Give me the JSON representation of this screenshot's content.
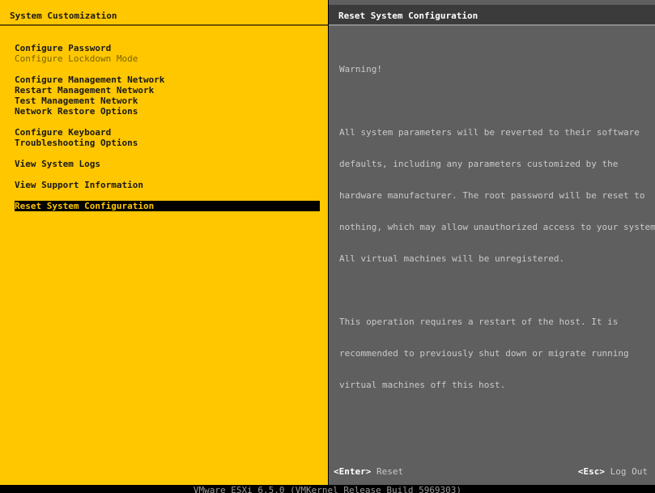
{
  "left_pane": {
    "title": "System Customization",
    "menu": [
      {
        "label": "Configure Password",
        "state": "normal"
      },
      {
        "label": "Configure Lockdown Mode",
        "state": "disabled"
      },
      {
        "label": "Configure Management Network",
        "state": "normal"
      },
      {
        "label": "Restart Management Network",
        "state": "normal"
      },
      {
        "label": "Test Management Network",
        "state": "normal"
      },
      {
        "label": "Network Restore Options",
        "state": "normal"
      },
      {
        "label": "Configure Keyboard",
        "state": "normal"
      },
      {
        "label": "Troubleshooting Options",
        "state": "normal"
      },
      {
        "label": "View System Logs",
        "state": "normal"
      },
      {
        "label": "View Support Information",
        "state": "normal"
      },
      {
        "label": "Reset System Configuration",
        "state": "selected"
      }
    ]
  },
  "right_pane": {
    "title": "Reset System Configuration",
    "warning_heading": "Warning!",
    "paragraph_1": [
      "All system parameters will be reverted to their software",
      "defaults, including any parameters customized by the",
      "hardware manufacturer. The root password will be reset to",
      "nothing, which may allow unauthorized access to your system.",
      "All virtual machines will be unregistered."
    ],
    "paragraph_2": [
      "This operation requires a restart of the host. It is",
      "recommended to previously shut down or migrate running",
      "virtual machines off this host."
    ]
  },
  "footer": {
    "enter_key": "<Enter>",
    "enter_action": "Reset",
    "esc_key": "<Esc>",
    "esc_action": "Log Out"
  },
  "status_bar": {
    "text": "VMware ESXi 6.5.0 (VMKernel Release Build 5969303)"
  },
  "colors": {
    "left_background": "#ffc700",
    "right_background": "#5f5f5f",
    "selection_background": "#000000",
    "selection_text": "#ffc700"
  }
}
